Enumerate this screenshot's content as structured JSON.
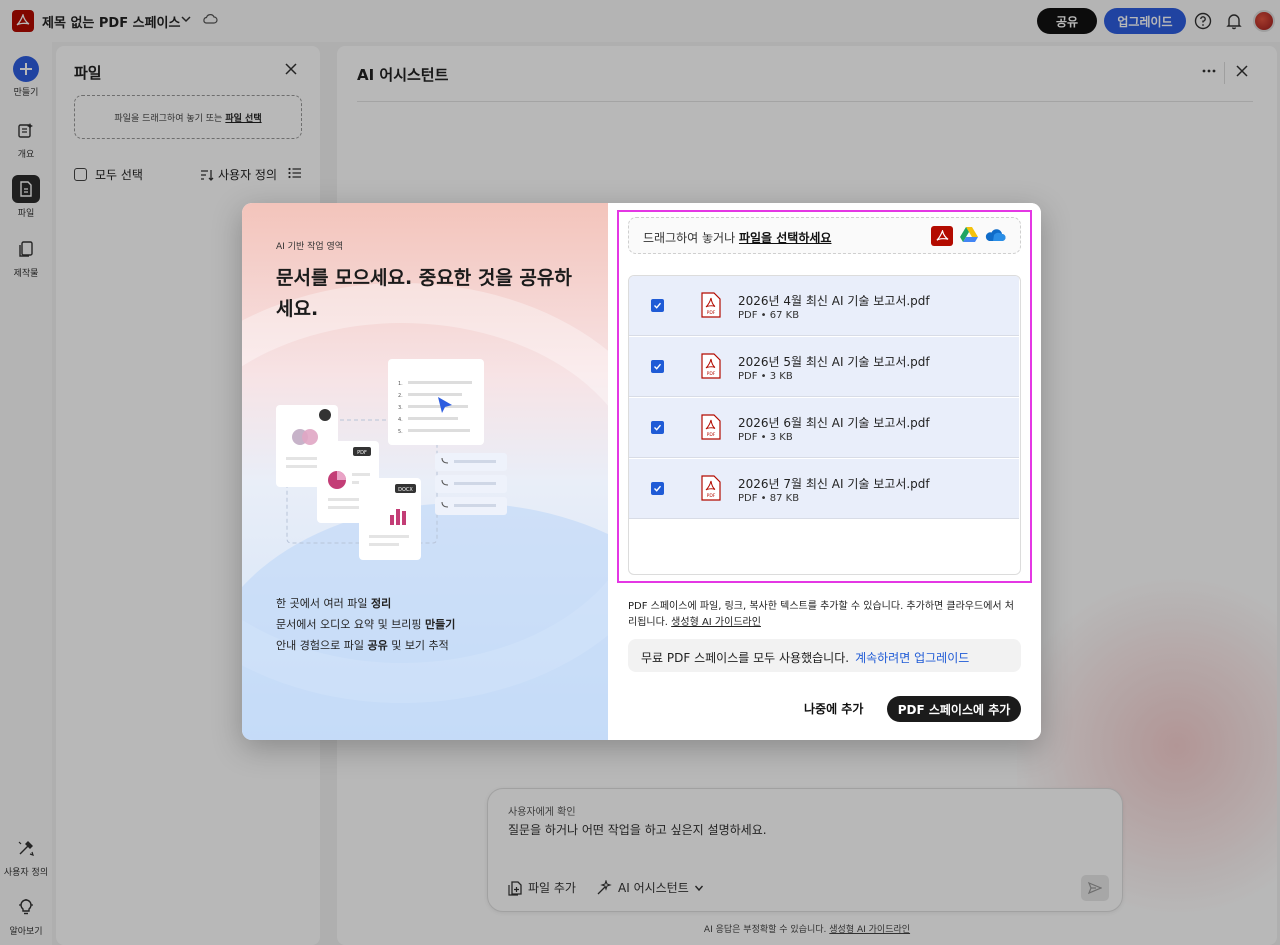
{
  "app": {
    "title": "제목 없는 PDF 스페이스",
    "share_label": "공유",
    "upgrade_label": "업그레이드"
  },
  "rail": {
    "items": [
      {
        "label": "만들기",
        "icon": "plus-icon"
      },
      {
        "label": "개요",
        "icon": "overview-icon"
      },
      {
        "label": "파일",
        "icon": "files-icon"
      },
      {
        "label": "제작물",
        "icon": "creations-icon"
      },
      {
        "label": "사용자 정의",
        "icon": "customize-icon"
      },
      {
        "label": "알아보기",
        "icon": "lightbulb-icon"
      }
    ]
  },
  "files_panel": {
    "title": "파일",
    "dropzone_text": "파일을 드래그하여 놓기 또는",
    "dropzone_link": "파일 선택",
    "select_all_label": "모두 선택",
    "sort_label": "사용자 정의"
  },
  "ai_panel": {
    "title": "AI 어시스턴트",
    "composer_label": "사용자에게 확인",
    "composer_placeholder": "질문을 하거나 어떤 작업을 하고 싶은지 설명하세요.",
    "add_file_label": "파일 추가",
    "assistant_menu_label": "AI 어시스턴트",
    "disclaimer_text": "AI 응답은 부정확할 수 있습니다.",
    "disclaimer_link": "생성형 AI 가이드라인"
  },
  "modal": {
    "eyebrow": "AI 기반 작업 영역",
    "headline": "문서를 모으세요. 중요한 것을 공유하세요.",
    "illus_labels": {
      "pdf": "PDF",
      "docx": "DOCX"
    },
    "bullets": [
      {
        "pre": "한 곳에서 여러 파일 ",
        "bold": "정리",
        "post": ""
      },
      {
        "pre": "문서에서 오디오 요약 및 브리핑 ",
        "bold": "만들기",
        "post": ""
      },
      {
        "pre": "안내 경험으로 파일 ",
        "bold": "공유",
        "post": " 및 보기 추적"
      }
    ],
    "upload_text": "드래그하여 놓거나",
    "upload_link": "파일을 선택하세요",
    "files": [
      {
        "name": "2026년 4월 최신 AI 기술 보고서.pdf",
        "meta": "PDF • 67 KB",
        "checked": true
      },
      {
        "name": "2026년 5월 최신 AI 기술 보고서.pdf",
        "meta": "PDF • 3 KB",
        "checked": true
      },
      {
        "name": "2026년 6월 최신 AI 기술 보고서.pdf",
        "meta": "PDF • 3 KB",
        "checked": true
      },
      {
        "name": "2026년 7월 최신 AI 기술 보고서.pdf",
        "meta": "PDF • 87 KB",
        "checked": true
      }
    ],
    "info_text": "PDF 스페이스에 파일, 링크, 복사한 텍스트를 추가할 수 있습니다. 추가하면 클라우드에서 처리됩니다.",
    "info_link": "생성형 AI 가이드라인",
    "notice_text": "무료 PDF 스페이스를 모두 사용했습니다.",
    "notice_link": "계속하려면 업그레이드",
    "later_label": "나중에 추가",
    "primary_label": "PDF 스페이스에 추가"
  },
  "colors": {
    "accent": "#2d5de0",
    "highlight": "#e437e4",
    "acrobat_red": "#b30b00",
    "checkbox_blue": "#1f5bd6"
  }
}
